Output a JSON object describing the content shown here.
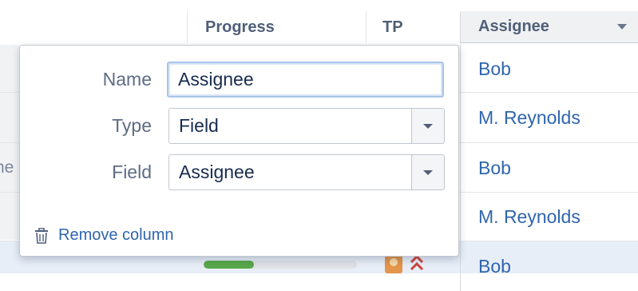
{
  "table": {
    "columns": {
      "progress": "Progress",
      "tp": "TP",
      "assignee": "Assignee"
    },
    "rows": [
      {
        "assignee": "Bob"
      },
      {
        "assignee": "M. Reynolds"
      },
      {
        "assignee": "Bob"
      },
      {
        "assignee": "M. Reynolds"
      },
      {
        "assignee": "Bob"
      }
    ],
    "partial_left_text": "ne",
    "last_row_progress": 0.33
  },
  "popup": {
    "name_label": "Name",
    "name_value": "Assignee",
    "type_label": "Type",
    "type_value": "Field",
    "field_label": "Field",
    "field_value": "Assignee",
    "remove_label": "Remove column"
  },
  "colors": {
    "link": "#2f65ad",
    "progress_fill": "#59a84b",
    "priority": "#d04437"
  },
  "icons": [
    "chevron-down-icon",
    "trash-icon",
    "lightbulb-icon",
    "priority-highest-icon"
  ]
}
